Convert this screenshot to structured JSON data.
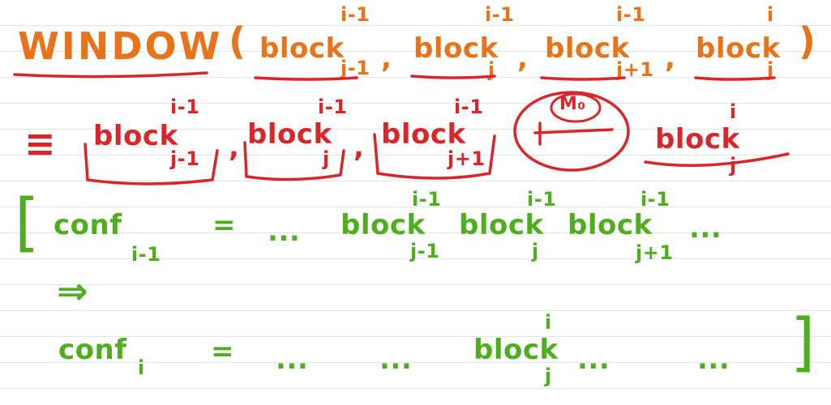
{
  "colors": {
    "orange": "#e8731a",
    "red": "#d8262a",
    "green": "#4fae1d",
    "rule": "#dfe6f0"
  },
  "line1": {
    "title": "WINDOW",
    "open_paren": "(",
    "close_paren": ")",
    "comma": ",",
    "args": [
      {
        "word": "block",
        "sup": "i-1",
        "sub": "j-1"
      },
      {
        "word": "block",
        "sup": "i-1",
        "sub": "j"
      },
      {
        "word": "block",
        "sup": "i-1",
        "sub": "j+1"
      },
      {
        "word": "block",
        "sup": "i",
        "sub": "j"
      }
    ]
  },
  "line2": {
    "equiv": "≡",
    "comma": ",",
    "blocks": [
      {
        "word": "block",
        "sup": "i-1",
        "sub": "j-1"
      },
      {
        "word": "block",
        "sup": "i-1",
        "sub": "j"
      },
      {
        "word": "block",
        "sup": "i-1",
        "sub": "j+1"
      },
      {
        "word": "block",
        "sup": "i",
        "sub": "j"
      }
    ],
    "machine_label": "M₀"
  },
  "line3": {
    "open_bracket": "[",
    "conf": "conf",
    "conf_sub": "i-1",
    "equals": "=",
    "dots_before": "...",
    "blocks": [
      {
        "word": "block",
        "sup": "i-1",
        "sub": "j-1"
      },
      {
        "word": "block",
        "sup": "i-1",
        "sub": "j"
      },
      {
        "word": "block",
        "sup": "i-1",
        "sub": "j+1"
      }
    ],
    "dots_after": "..."
  },
  "line4": {
    "implies": "⇒"
  },
  "line5": {
    "conf": "conf",
    "conf_sub": "i",
    "equals": "=",
    "dots_1": "...",
    "dots_2": "...",
    "block": {
      "word": "block",
      "sup": "i",
      "sub": "j"
    },
    "dots_3": "...",
    "dots_4": "...",
    "close_bracket": "]"
  }
}
